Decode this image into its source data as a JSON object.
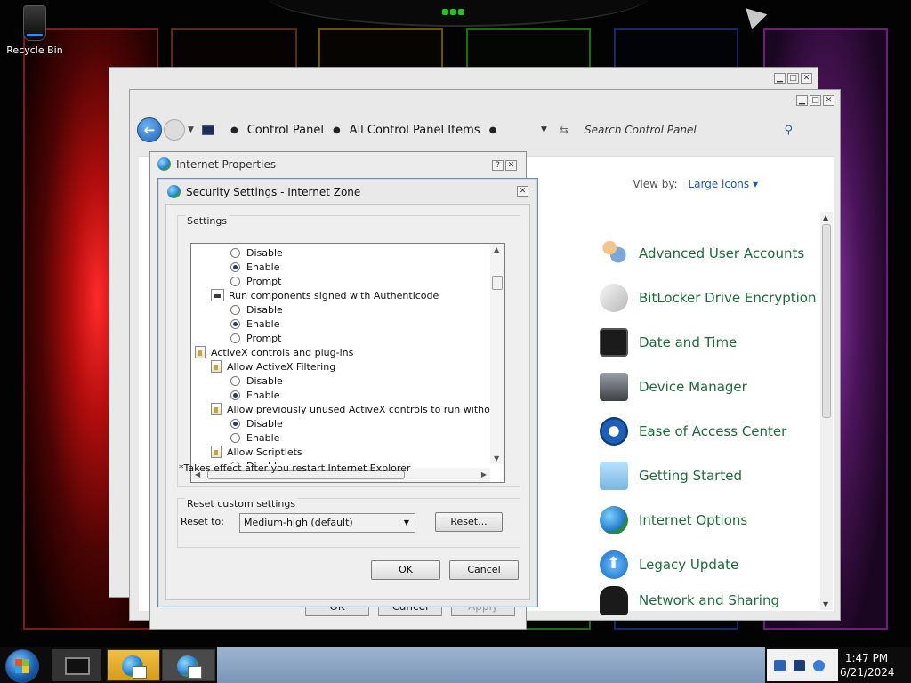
{
  "desktop": {
    "recycle_bin_label": "Recycle Bin"
  },
  "control_panel": {
    "breadcrumb": [
      "Control Panel",
      "All Control Panel Items"
    ],
    "search_placeholder": "Search Control Panel",
    "view_by_label": "View by:",
    "view_by_value": "Large icons",
    "items": [
      {
        "label": "Advanced User Accounts",
        "icon": "user-accounts-icon"
      },
      {
        "label": "BitLocker Drive Encryption",
        "icon": "bitlocker-icon"
      },
      {
        "label": "Date and Time",
        "icon": "date-time-icon"
      },
      {
        "label": "Device Manager",
        "icon": "device-manager-icon"
      },
      {
        "label": "Ease of Access Center",
        "icon": "ease-of-access-icon"
      },
      {
        "label": "Getting Started",
        "icon": "getting-started-icon"
      },
      {
        "label": "Internet Options",
        "icon": "internet-options-icon"
      },
      {
        "label": "Legacy Update",
        "icon": "legacy-update-icon"
      },
      {
        "label": "Network and Sharing",
        "icon": "network-sharing-icon"
      }
    ]
  },
  "internet_properties": {
    "title": "Internet Properties",
    "ok_label": "OK",
    "cancel_label": "Cancel",
    "apply_label": "Apply"
  },
  "security_settings": {
    "title": "Security Settings - Internet Zone",
    "settings_group_label": "Settings",
    "rows": [
      {
        "type": "radio",
        "level": 2,
        "label": "Disable",
        "checked": false
      },
      {
        "type": "radio",
        "level": 2,
        "label": "Enable",
        "checked": true
      },
      {
        "type": "radio",
        "level": 2,
        "label": "Prompt",
        "checked": false
      },
      {
        "type": "setting",
        "level": 1,
        "icon": "certificate-icon",
        "label": "Run components signed with Authenticode"
      },
      {
        "type": "radio",
        "level": 2,
        "label": "Disable",
        "checked": false
      },
      {
        "type": "radio",
        "level": 2,
        "label": "Enable",
        "checked": true
      },
      {
        "type": "radio",
        "level": 2,
        "label": "Prompt",
        "checked": false
      },
      {
        "type": "category",
        "level": 0,
        "icon": "scroll-icon",
        "label": "ActiveX controls and plug-ins"
      },
      {
        "type": "setting",
        "level": 1,
        "icon": "scroll-icon",
        "label": "Allow ActiveX Filtering"
      },
      {
        "type": "radio",
        "level": 2,
        "label": "Disable",
        "checked": false
      },
      {
        "type": "radio",
        "level": 2,
        "label": "Enable",
        "checked": true
      },
      {
        "type": "setting",
        "level": 1,
        "icon": "scroll-icon",
        "label": "Allow previously unused ActiveX controls to run without prom"
      },
      {
        "type": "radio",
        "level": 2,
        "label": "Disable",
        "checked": true
      },
      {
        "type": "radio",
        "level": 2,
        "label": "Enable",
        "checked": false
      },
      {
        "type": "setting",
        "level": 1,
        "icon": "scroll-icon",
        "label": "Allow Scriptlets"
      },
      {
        "type": "radio",
        "level": 2,
        "label": "Disable",
        "checked": true
      }
    ],
    "restart_note": "*Takes effect after you restart Internet Explorer",
    "reset_group_label": "Reset custom settings",
    "reset_to_label": "Reset to:",
    "reset_to_value": "Medium-high (default)",
    "reset_button": "Reset...",
    "ok_button": "OK",
    "cancel_button": "Cancel"
  },
  "taskbar": {
    "clock_time": "1:47 PM",
    "clock_date": "6/21/2024"
  }
}
